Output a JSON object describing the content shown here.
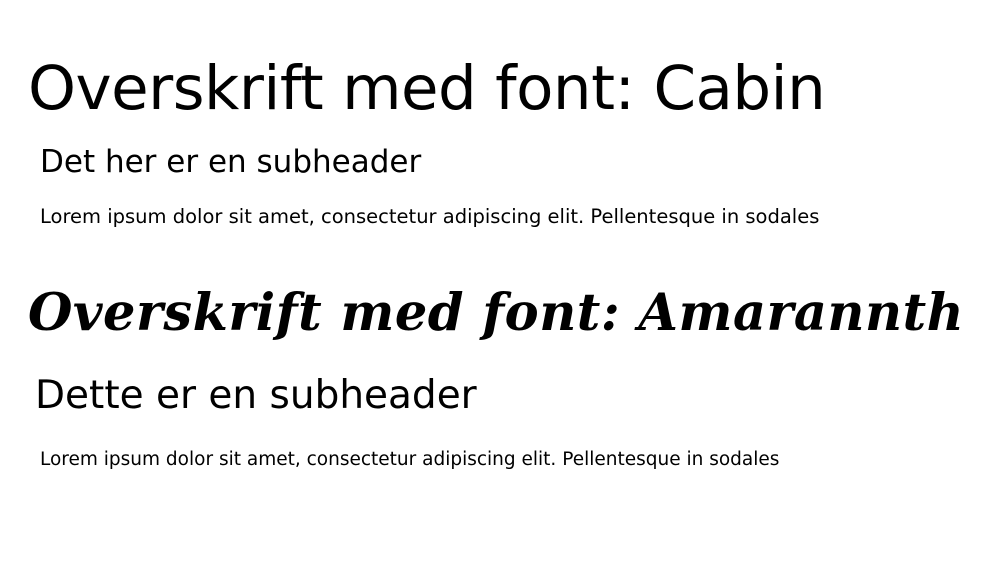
{
  "sections": [
    {
      "heading": "Overskrift med font: Cabin",
      "subheader": "Det her er en subheader",
      "body": "Lorem ipsum dolor sit amet, consectetur adipiscing elit. Pellentesque in sodales"
    },
    {
      "heading": "Overskrift med font: Amarannth",
      "subheader": "Dette er en subheader",
      "body": "Lorem ipsum dolor sit amet, consectetur adipiscing elit. Pellentesque in sodales"
    }
  ]
}
